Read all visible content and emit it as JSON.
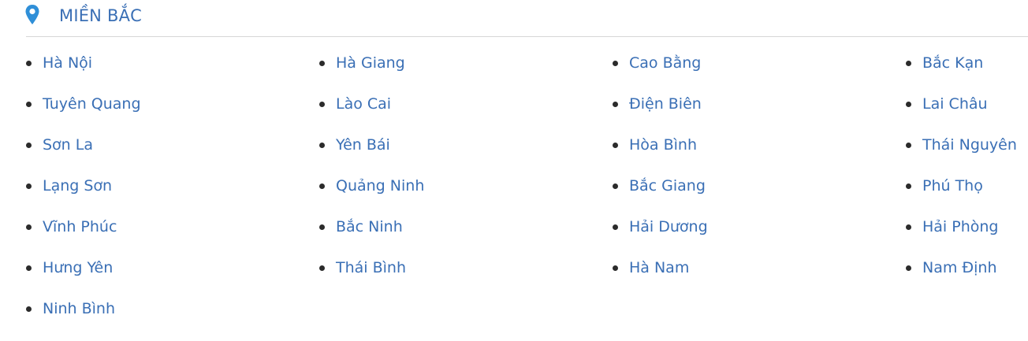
{
  "header": {
    "title": "MIỀN BẮC",
    "icon": "map-pin-icon",
    "accent_color": "#2f8fd8",
    "text_color": "#3a6fb5"
  },
  "provinces": [
    "Hà Nội",
    "Hà Giang",
    "Cao Bằng",
    "Bắc Kạn",
    "Tuyên Quang",
    "Lào Cai",
    "Điện Biên",
    "Lai Châu",
    "Sơn La",
    "Yên Bái",
    "Hòa Bình",
    "Thái Nguyên",
    "Lạng Sơn",
    "Quảng Ninh",
    "Bắc Giang",
    "Phú Thọ",
    "Vĩnh Phúc",
    "Bắc Ninh",
    "Hải Dương",
    "Hải Phòng",
    "Hưng Yên",
    "Thái Bình",
    "Hà Nam",
    "Nam Định",
    "Ninh Bình"
  ]
}
